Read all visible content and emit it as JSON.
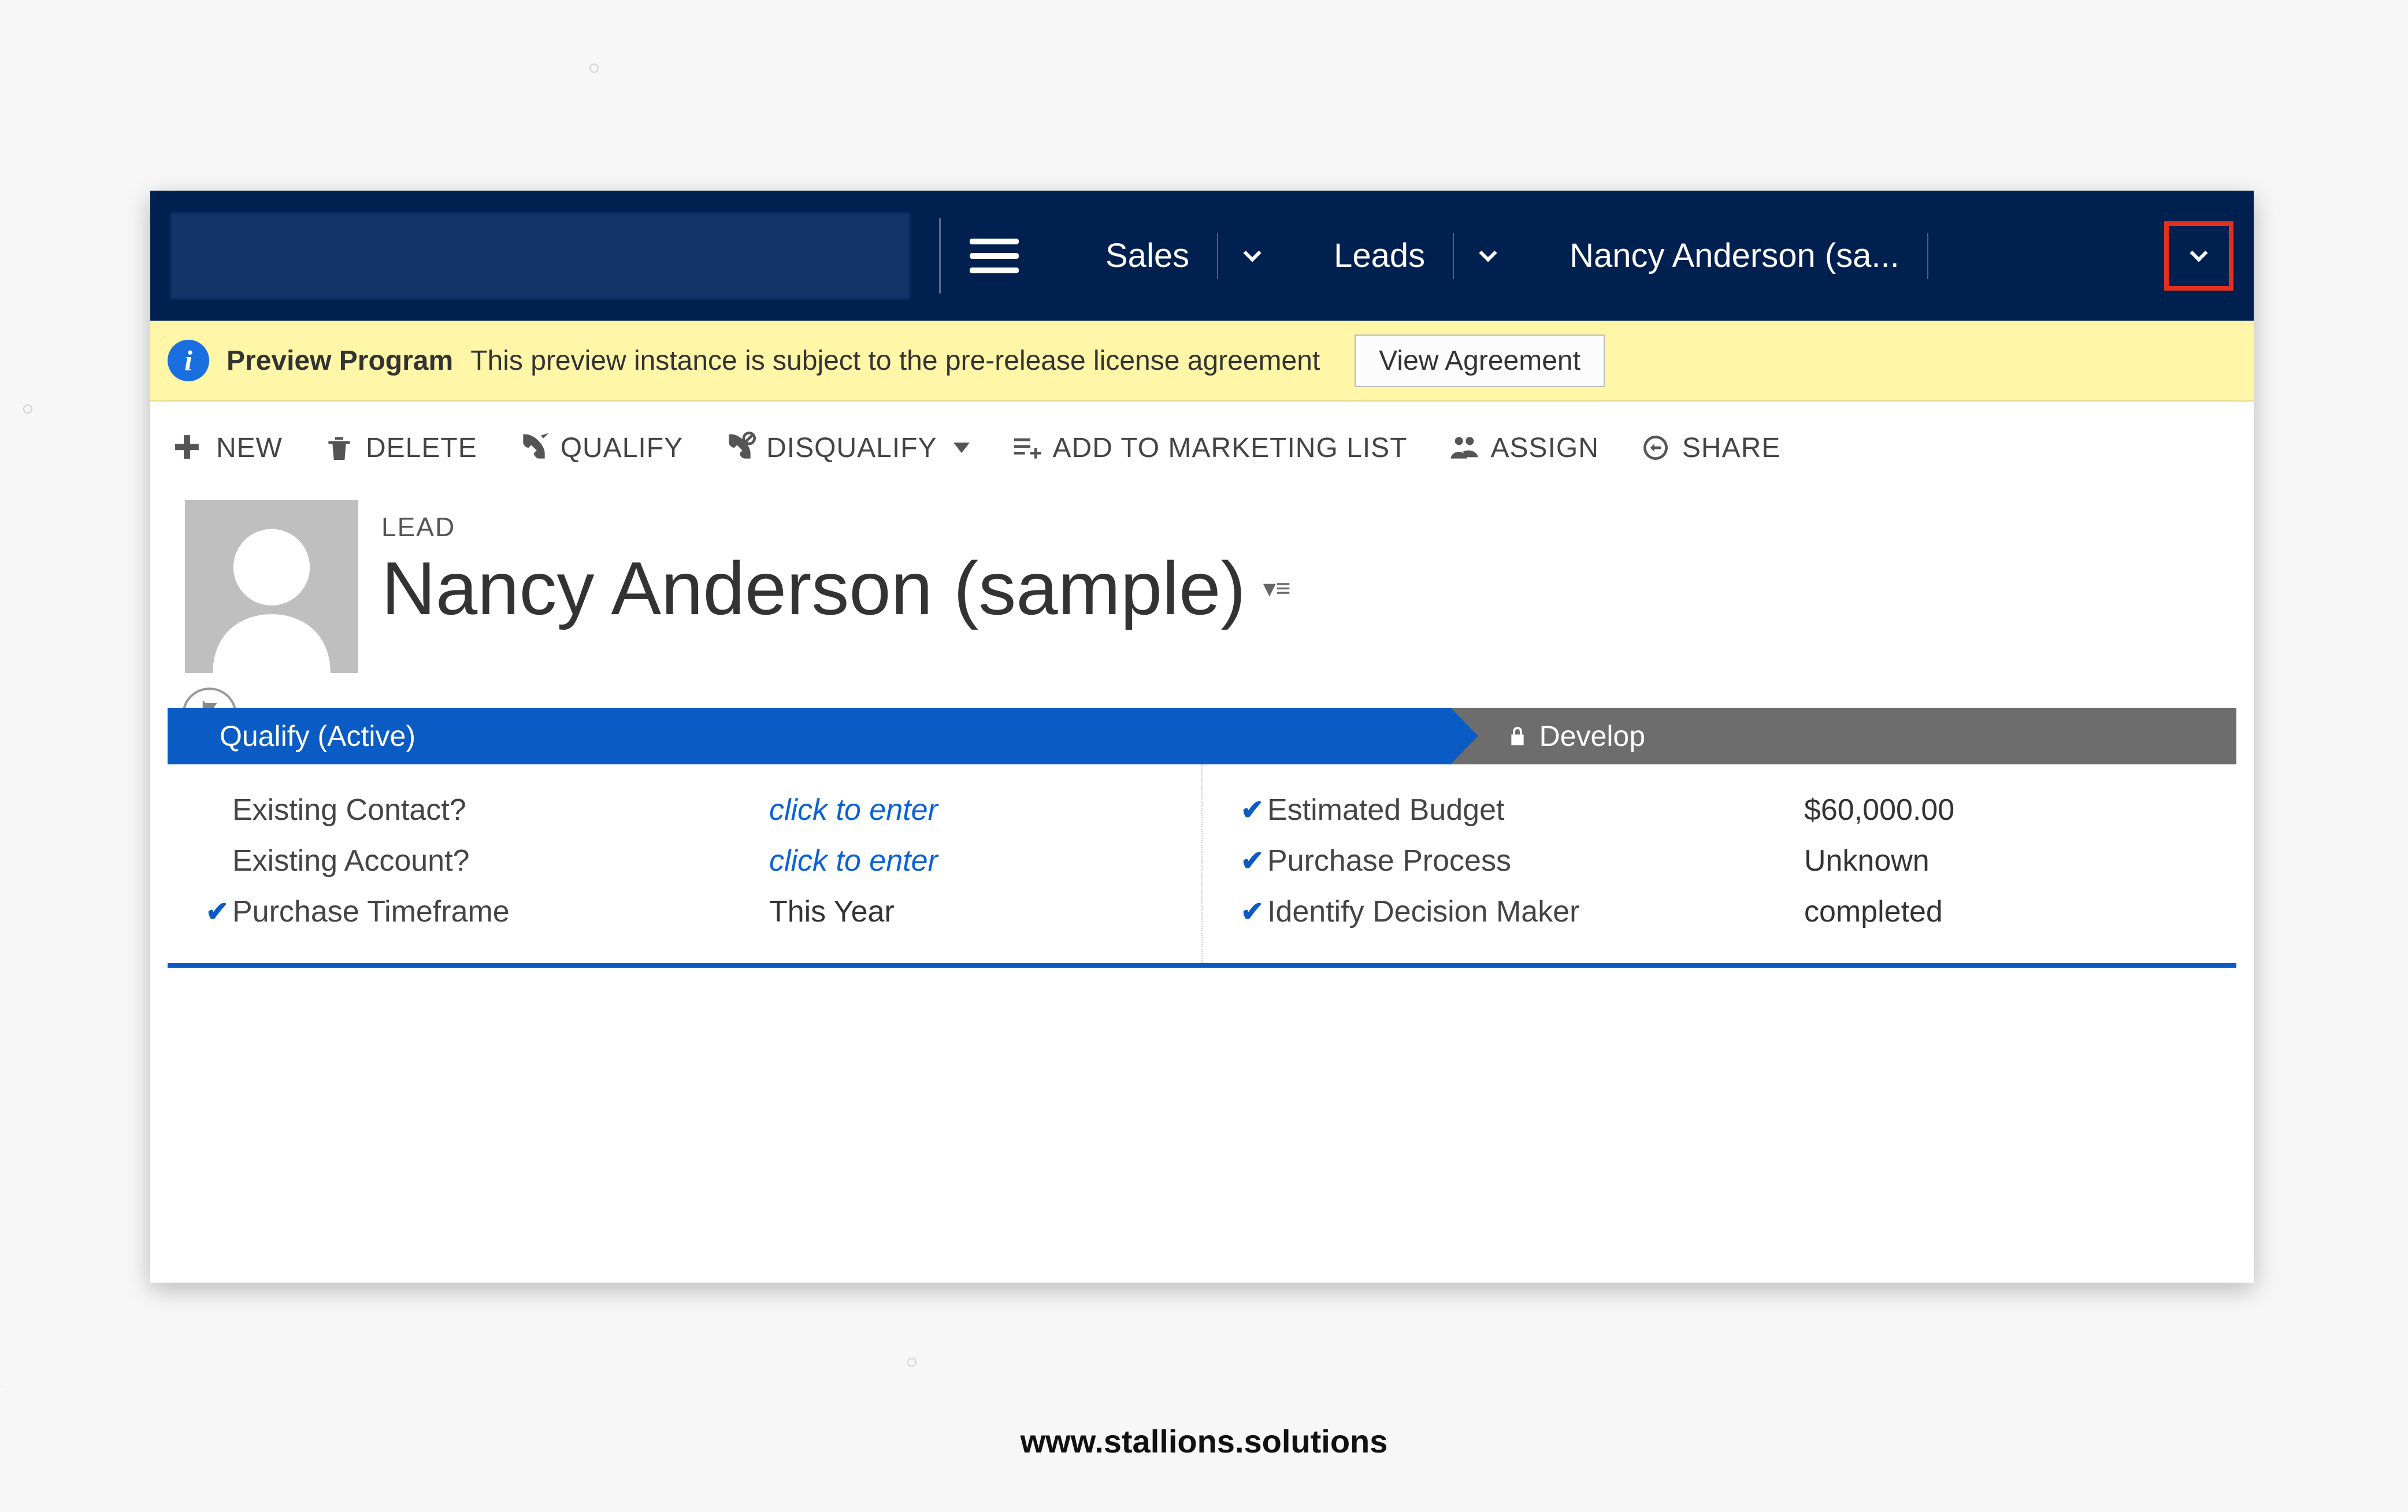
{
  "nav": {
    "area": "Sales",
    "entity": "Leads",
    "record": "Nancy Anderson (sa..."
  },
  "notice": {
    "title": "Preview Program",
    "message": "This preview instance is subject to the pre-release license agreement",
    "button": "View Agreement"
  },
  "commands": {
    "new": "NEW",
    "delete": "DELETE",
    "qualify": "QUALIFY",
    "disqualify": "DISQUALIFY",
    "add_to_marketing_list": "ADD TO MARKETING LIST",
    "assign": "ASSIGN",
    "share": "SHARE"
  },
  "header": {
    "entity_label": "LEAD",
    "entity_name": "Nancy Anderson (sample)"
  },
  "bpf": {
    "stage_active": "Qualify (Active)",
    "stage_next": "Develop"
  },
  "fields": {
    "left": [
      {
        "checked": false,
        "label": "Existing Contact?",
        "value": "click to enter",
        "link": true
      },
      {
        "checked": false,
        "label": "Existing Account?",
        "value": "click to enter",
        "link": true
      },
      {
        "checked": true,
        "label": "Purchase Timeframe",
        "value": "This Year",
        "link": false
      }
    ],
    "right": [
      {
        "checked": true,
        "label": "Estimated Budget",
        "value": "$60,000.00",
        "link": false
      },
      {
        "checked": true,
        "label": "Purchase Process",
        "value": "Unknown",
        "link": false
      },
      {
        "checked": true,
        "label": "Identify Decision Maker",
        "value": "completed",
        "link": false
      }
    ]
  },
  "watermark": "www.stallions.solutions"
}
